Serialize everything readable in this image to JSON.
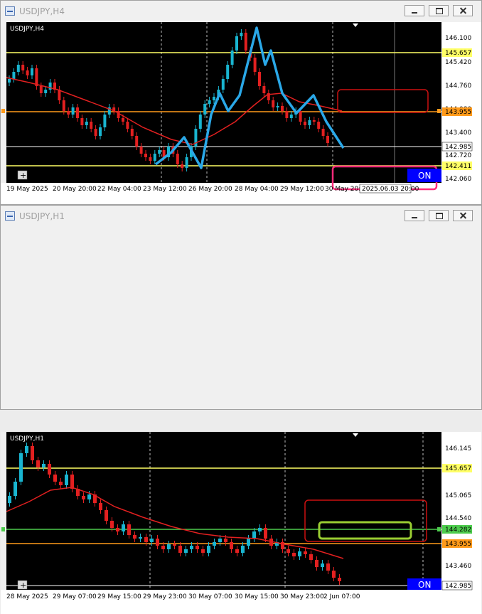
{
  "top": {
    "window_title": "USDJPY,H4",
    "chart_label": "USDJPY,H4",
    "price_labels": [
      "146.100",
      "145.420",
      "144.760",
      "144.080",
      "143.400",
      "142.720",
      "142.060"
    ],
    "level_yellow_upper": "145.657",
    "level_orange": "143.955",
    "level_white": "142.985",
    "level_yellow_lower": "142.411",
    "time_labels": [
      "19 May 2025",
      "20 May 20:00",
      "22 May 04:00",
      "23 May 12:00",
      "26 May 20:00",
      "28 May 04:00",
      "29 May 12:00",
      "30 May 20:00"
    ],
    "cursor_time": "2025.06.03 20:00",
    "on_badge": "ON",
    "plus_button": "+"
  },
  "bottom": {
    "window_title": "USDJPY,H1",
    "chart_label": "USDJPY,H1",
    "price_labels": [
      "146.145",
      "145.065",
      "144.540",
      "143.460"
    ],
    "level_yellow": "145.657",
    "level_green": "144.282",
    "level_orange": "143.955",
    "level_white": "142.985",
    "time_labels": [
      "28 May 2025",
      "29 May 07:00",
      "29 May 15:00",
      "29 May 23:00",
      "30 May 07:00",
      "30 May 15:00",
      "30 May 23:00",
      "2 Jun 07:00"
    ],
    "on_badge": "ON",
    "plus_button": "+"
  },
  "colors": {
    "chart_bg": "#000000",
    "bull": "#19b5d0",
    "bear": "#e32020",
    "ma": "#e32020",
    "wave": "#2aa8e8",
    "yellow": "#ffff66",
    "orange": "#ff9a1a",
    "green": "#4dcc4d",
    "badge": "#0000ff",
    "annot_pink": "#ff2a7a",
    "annot_green": "#9acd32"
  }
}
